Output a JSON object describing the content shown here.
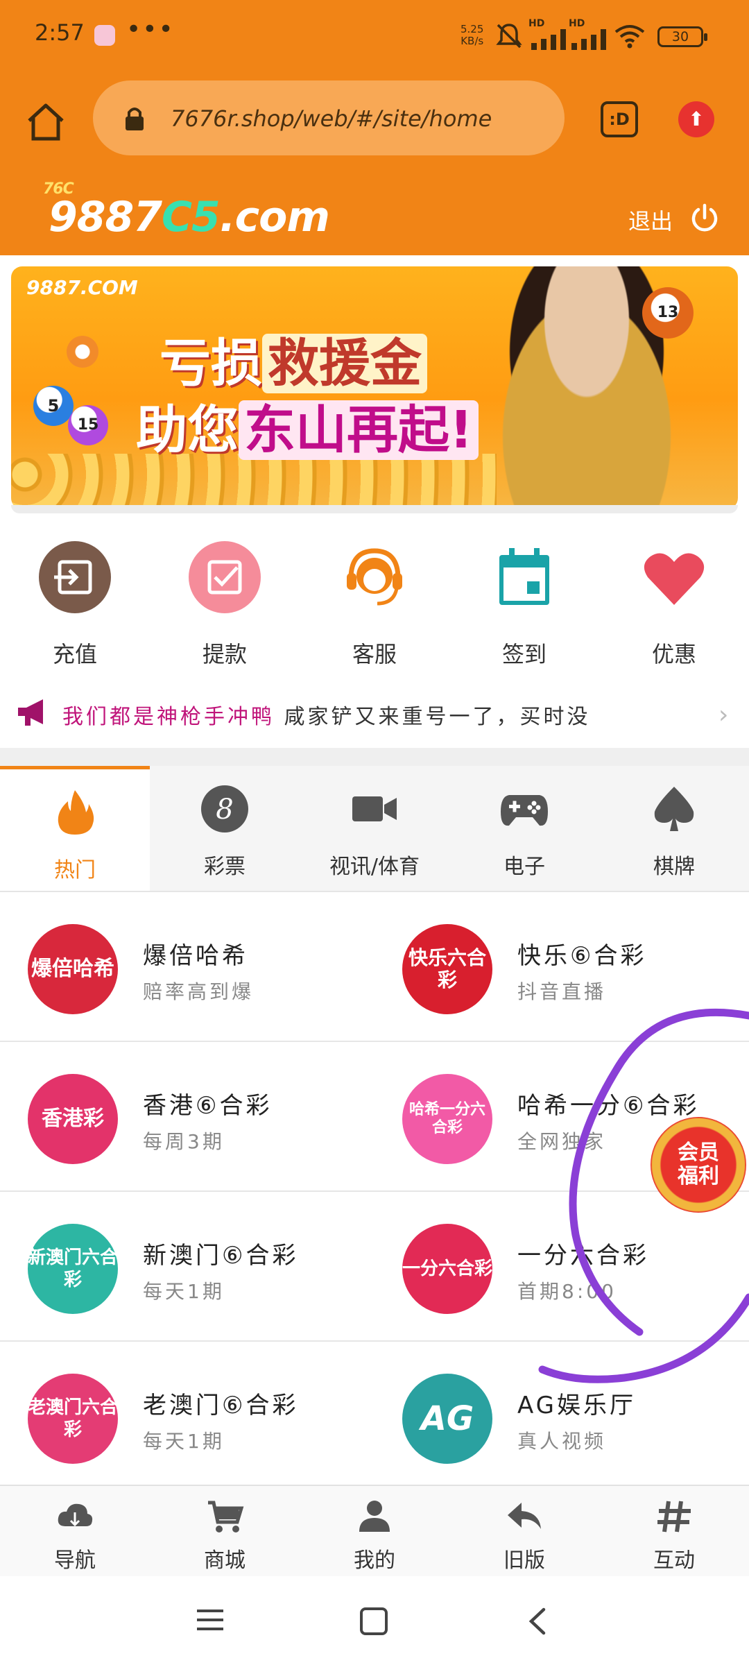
{
  "status_bar": {
    "time": "2:57",
    "more": "•••",
    "speed_value": "5.25",
    "speed_unit": "KB/s",
    "signal1": "HD",
    "signal2": "HD",
    "battery": "30"
  },
  "browser": {
    "url": "7676r.shop/web/#/site/home",
    "tab_label": ":D"
  },
  "site": {
    "logo_main": "9887",
    "logo_accent": "C5",
    "logo_suffix": ".com",
    "logo_small": "76C",
    "logout_label": "退出"
  },
  "banner": {
    "brand": "9887.COM",
    "line1_a": "亏损",
    "line1_b": "救援金",
    "line2_a": "助您",
    "line2_b": "东山再起!",
    "ball1": "5",
    "ball2": "15",
    "ball3": "13"
  },
  "quick_actions": [
    {
      "label": "充值",
      "color": "#7a5a4a"
    },
    {
      "label": "提款",
      "color": "#f58c9a"
    },
    {
      "label": "客服",
      "color": "#f18416"
    },
    {
      "label": "签到",
      "color": "#1aa3a8"
    },
    {
      "label": "优惠",
      "color": "#e94b5d"
    }
  ],
  "marquee": {
    "highlight": "我们都是神枪手冲鸭",
    "text": "咸家铲又来重号一了，买时没"
  },
  "category_tabs": [
    {
      "label": "热门",
      "icon": "flame-icon",
      "active": true
    },
    {
      "label": "彩票",
      "icon": "lottery-8-icon",
      "active": false
    },
    {
      "label": "视讯/体育",
      "icon": "video-camera-icon",
      "active": false
    },
    {
      "label": "电子",
      "icon": "gamepad-icon",
      "active": false
    },
    {
      "label": "棋牌",
      "icon": "spade-icon",
      "active": false
    }
  ],
  "games": [
    {
      "title": "爆倍哈希",
      "sub": "赔率高到爆",
      "thumb": "爆倍哈希",
      "color": "#d8283c"
    },
    {
      "title": "快乐⑥合彩",
      "sub": "抖音直播",
      "thumb": "快乐六合彩",
      "color": "#d81f2e"
    },
    {
      "title": "香港⑥合彩",
      "sub": "每周3期",
      "thumb": "香港彩",
      "color": "#e3336a"
    },
    {
      "title": "哈希一分⑥合彩",
      "sub": "全网独家",
      "thumb": "哈希一分六合彩",
      "color": "#f25aa6"
    },
    {
      "title": "新澳门⑥合彩",
      "sub": "每天1期",
      "thumb": "新澳门六合彩",
      "color": "#2db6a3"
    },
    {
      "title": "一分六合彩",
      "sub": "首期8:00",
      "thumb": "一分六合彩",
      "color": "#e22a55"
    },
    {
      "title": "老澳门⑥合彩",
      "sub": "每天1期",
      "thumb": "老澳门六合彩",
      "color": "#e43c74"
    },
    {
      "title": "AG娱乐厅",
      "sub": "真人视频",
      "thumb": "AG",
      "color": "#2aa1a0"
    }
  ],
  "member_badge": {
    "line1": "会员",
    "line2": "福利"
  },
  "bottom_nav": [
    {
      "label": "导航",
      "icon": "cloud-download-icon"
    },
    {
      "label": "商城",
      "icon": "shopping-cart-icon"
    },
    {
      "label": "我的",
      "icon": "user-icon"
    },
    {
      "label": "旧版",
      "icon": "reply-arrow-icon"
    },
    {
      "label": "互动",
      "icon": "hashtag-icon"
    }
  ],
  "colors": {
    "brand_orange": "#f18416",
    "accent_teal": "#38e0b0",
    "annotation_purple": "#8a3fd6"
  }
}
